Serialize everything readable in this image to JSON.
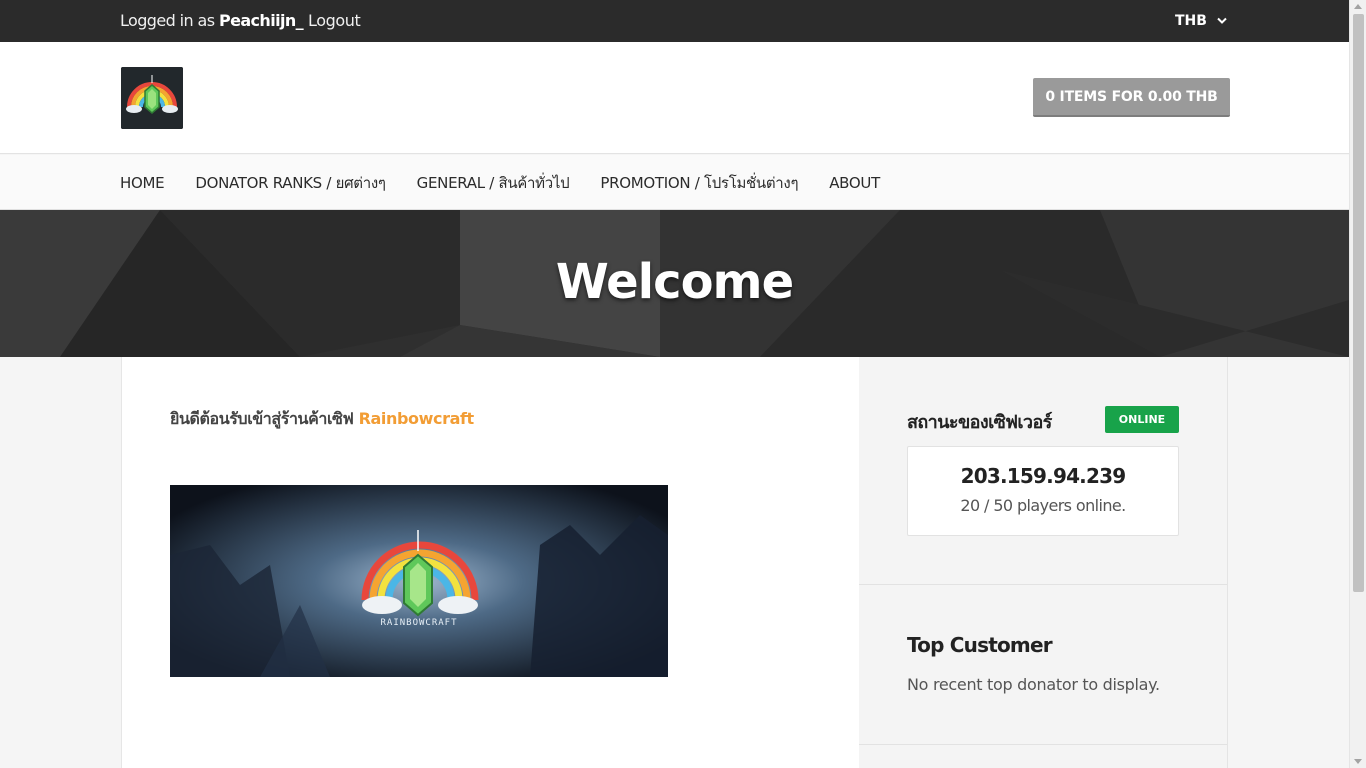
{
  "topbar": {
    "logged_prefix": "Logged in as",
    "username": "Peachiijn_",
    "logout": "Logout",
    "currency": "THB"
  },
  "header": {
    "cart": "0 ITEMS FOR 0.00 THB"
  },
  "nav": {
    "items": [
      {
        "label": "HOME"
      },
      {
        "label": "DONATOR RANKS / ยศต่างๆ"
      },
      {
        "label": "GENERAL / สินค้าทั่วไป"
      },
      {
        "label": "PROMOTION / โปรโมชั่นต่างๆ"
      },
      {
        "label": "ABOUT"
      }
    ]
  },
  "hero": {
    "title": "Welcome"
  },
  "main": {
    "welcome_text": "ยินดีต้อนรับเข้าสู่ร้านค้าเซิฟ",
    "brand": "Rainbowcraft",
    "banner_caption": "RAINBOWCRAFT"
  },
  "sidebar": {
    "status": {
      "title": "สถานะของเซิฟเวอร์",
      "badge": "ONLINE",
      "ip": "203.159.94.239",
      "players": "20 / 50 players online."
    },
    "top_customer": {
      "title": "Top Customer",
      "text": "No recent top donator to display."
    }
  },
  "colors": {
    "accent_brand": "#f29d35",
    "online_badge": "#18a34a",
    "topbar_bg": "#2b2b2b",
    "cart_button": "#9a9a9a"
  },
  "icons": {
    "currency_dropdown": "chevron-down-icon"
  }
}
